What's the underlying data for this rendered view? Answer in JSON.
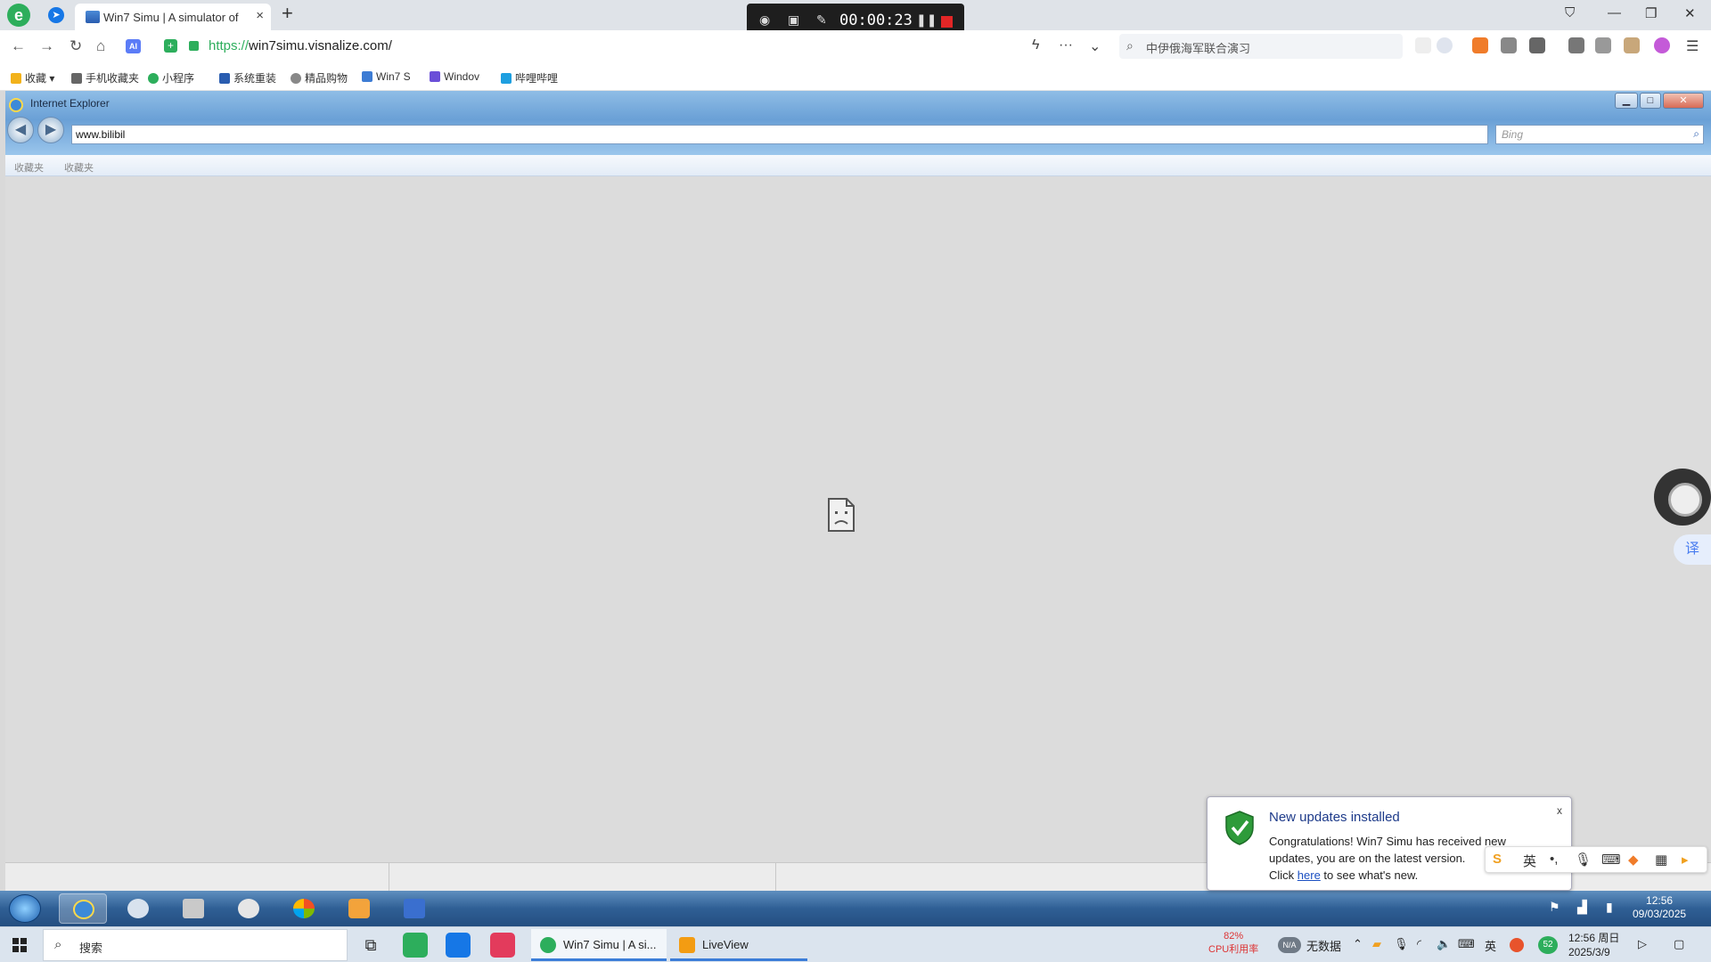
{
  "host_browser": {
    "tab_title": "Win7 Simu | A simulator of",
    "new_tab_symbol": "+",
    "url_scheme": "https://",
    "url_rest": "win7simu.visnalize.com/",
    "search_text": "中伊俄海军联合演习",
    "recorder_time": "00:00:23",
    "bookmarks": [
      {
        "label": "收藏",
        "icon": "star-icon",
        "color": "#f2b21b"
      },
      {
        "label": "手机收藏夹",
        "icon": "phone-icon",
        "color": "#666666"
      },
      {
        "label": "小程序",
        "icon": "miniapp-icon",
        "color": "#2dae5c"
      },
      {
        "label": "系统重装",
        "icon": "system-icon",
        "color": "#2a5db0"
      },
      {
        "label": "精品购物",
        "icon": "shopping-icon",
        "color": "#888888"
      },
      {
        "label": "Win7 S",
        "icon": "win7-icon",
        "color": "#3d7cd4"
      },
      {
        "label": "Windov",
        "icon": "windows-icon",
        "color": "#6b4fd8"
      },
      {
        "label": "哔哩哔哩",
        "icon": "bilibili-icon",
        "color": "#1e9fe0"
      }
    ]
  },
  "ie": {
    "title": "Internet Explorer",
    "url_value": "www.bilibil",
    "search_placeholder": "Bing",
    "fav_items": [
      "收藏夹",
      "收藏夹"
    ]
  },
  "toast": {
    "title": "New updates installed",
    "body_line1": "Congratulations! Win7 Simu has received new updates, you are on the latest version.",
    "body_prefix": "Click ",
    "link_text": "here",
    "body_suffix": " to see what's new.",
    "close_label": "x"
  },
  "sim_clock": {
    "time": "12:56",
    "date": "09/03/2025"
  },
  "ime": {
    "lang": "英",
    "punct": "•,"
  },
  "translate_label": "译",
  "host_taskbar": {
    "search_placeholder": "搜索",
    "tasks": [
      {
        "label": "Win7 Simu | A si...",
        "color": "#2dae5c"
      },
      {
        "label": "LiveView",
        "color": "#f39c12"
      }
    ],
    "cpu_percent": "82%",
    "cpu_label": "CPU利用率",
    "weather_label": "无数据",
    "weather_badge": "N/A",
    "lang": "英",
    "badge_count": "52",
    "clock_time": "12:56 周日",
    "clock_date": "2025/3/9"
  }
}
